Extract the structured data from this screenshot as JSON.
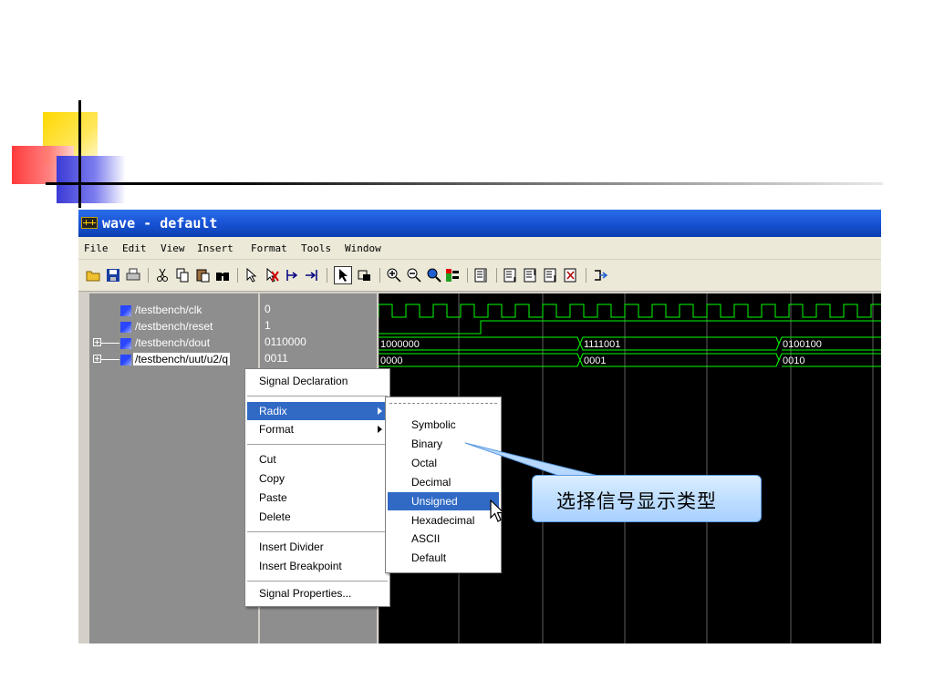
{
  "window": {
    "title": "wave - default",
    "icon": "waveform-icon"
  },
  "menubar": {
    "items": [
      "File",
      "Edit",
      "View",
      "Insert",
      "Format",
      "Tools",
      "Window"
    ]
  },
  "toolbar": {
    "icons": [
      "open-folder-icon",
      "save-icon",
      "print-icon",
      "cut-icon",
      "copy-icon",
      "paste-icon",
      "find-icon",
      "select-pointer-icon",
      "delete-signal-icon",
      "insert-cursor-icon",
      "delete-cursor-icon",
      "select-mode-icon",
      "zoom-mode-icon",
      "zoom-in-icon",
      "zoom-out-icon",
      "zoom-full-icon",
      "zoom-range-icon",
      "find-previous-edge-icon",
      "find-first-edge-icon",
      "find-next-edge-icon",
      "find-last-edge-icon",
      "find-falling-edge-icon",
      "clear-icon",
      "run-icon"
    ]
  },
  "signals": [
    {
      "name": "/testbench/clk",
      "value": "0",
      "expandable": false
    },
    {
      "name": "/testbench/reset",
      "value": "1",
      "expandable": false
    },
    {
      "name": "/testbench/dout",
      "value": "0110000",
      "expandable": true
    },
    {
      "name": "/testbench/uut/u2/q",
      "display_name": "/testbench/uut/u2/q",
      "value": "0011",
      "expandable": true,
      "selected": true
    }
  ],
  "waveform_labels": {
    "dout": [
      "1000000",
      "1111001",
      "0100100"
    ],
    "q": [
      "0000",
      "0001",
      "0010"
    ]
  },
  "context_menu": {
    "items": [
      {
        "label": "Signal Declaration"
      },
      {
        "label": "Radix",
        "submenu": true,
        "highlighted": true
      },
      {
        "label": "Format",
        "submenu": true
      },
      {
        "label": "Cut"
      },
      {
        "label": "Copy"
      },
      {
        "label": "Paste"
      },
      {
        "label": "Delete"
      },
      {
        "label": "Insert Divider"
      },
      {
        "label": "Insert Breakpoint"
      },
      {
        "label": "Signal Properties..."
      }
    ]
  },
  "radix_menu": {
    "items": [
      {
        "label": "Symbolic"
      },
      {
        "label": "Binary"
      },
      {
        "label": "Octal"
      },
      {
        "label": "Decimal"
      },
      {
        "label": "Unsigned",
        "highlighted": true
      },
      {
        "label": "Hexadecimal"
      },
      {
        "label": "ASCII"
      },
      {
        "label": "Default"
      }
    ]
  },
  "callout": {
    "text": "选择信号显示类型"
  },
  "colors": {
    "title_bar": "#1a55d8",
    "menu_highlight": "#316ac5",
    "waveform": "#00ff00",
    "signal_flag": "#2a46ff",
    "callout_fill": "#bfe0ff"
  }
}
